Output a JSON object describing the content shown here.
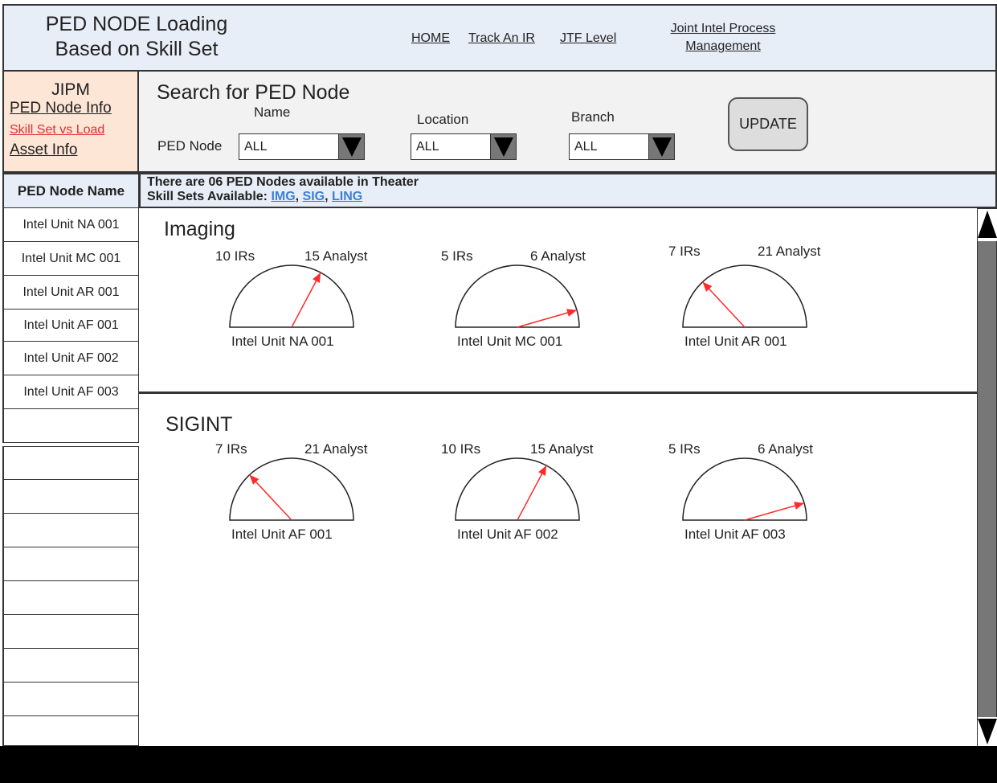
{
  "header": {
    "title_line1": "PED NODE Loading",
    "title_line2": "Based on Skill Set",
    "nav": [
      {
        "label": "HOME"
      },
      {
        "label": "Track An IR"
      },
      {
        "label": "JTF Level"
      },
      {
        "label_line1": "Joint Intel Process",
        "label_line2": "Management"
      }
    ]
  },
  "jipm": {
    "title": "JIPM",
    "links": [
      "PED Node Info",
      "Skill Set vs Load",
      "Asset Info"
    ]
  },
  "search": {
    "title": "Search for PED Node",
    "ped_node_label": "PED Node",
    "name_label": "Name",
    "location_label": "Location",
    "branch_label": "Branch",
    "name_value": "ALL",
    "location_value": "ALL",
    "branch_value": "ALL",
    "update_label": "UPDATE"
  },
  "list": {
    "header": "PED Node Name",
    "items": [
      "Intel Unit NA 001",
      "Intel Unit MC 001",
      "Intel Unit AR 001",
      "Intel Unit AF 001",
      "Intel Unit AF 002",
      "Intel Unit AF 003"
    ]
  },
  "info": {
    "line1": "There are 06 PED Nodes available in Theater",
    "skills_label": "Skill Sets Available: ",
    "skills": [
      "IMG",
      "SIG",
      "LING"
    ],
    "sep": ", "
  },
  "sections": [
    {
      "title": "Imaging",
      "gauges": [
        {
          "irs": "10 IRs",
          "analysts": "15 Analyst",
          "unit": "Intel Unit NA 001",
          "needle_deg": 62
        },
        {
          "irs": "5 IRs",
          "analysts": "6 Analyst",
          "unit": "Intel Unit MC 001",
          "needle_deg": 16
        },
        {
          "irs": "7 IRs",
          "analysts": "21 Analyst",
          "unit": "Intel Unit AR 001",
          "needle_deg": 133
        }
      ]
    },
    {
      "title": "SIGINT",
      "gauges": [
        {
          "irs": "7 IRs",
          "analysts": "21 Analyst",
          "unit": "Intel Unit AF 001",
          "needle_deg": 133
        },
        {
          "irs": "10 IRs",
          "analysts": "15 Analyst",
          "unit": "Intel Unit AF 002",
          "needle_deg": 62
        },
        {
          "irs": "5 IRs",
          "analysts": "6 Analyst",
          "unit": "Intel Unit AF 003",
          "needle_deg": 16
        }
      ]
    }
  ],
  "colors": {
    "needle": "#ff2a2a",
    "link_red": "#e03030",
    "skill_blue": "#3a7fd5",
    "header_bg": "#e8eef8",
    "jipm_bg": "#fde6d6"
  }
}
